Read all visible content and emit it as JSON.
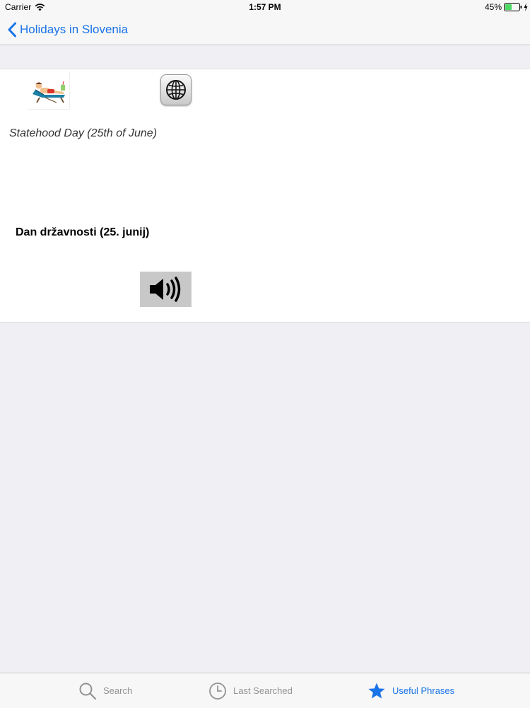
{
  "status_bar": {
    "carrier": "Carrier",
    "time": "1:57 PM",
    "battery": "45%",
    "icons": [
      "wifi-icon",
      "battery-icon",
      "charging-icon"
    ]
  },
  "nav": {
    "back_label": "Holidays in Slovenia"
  },
  "phrase": {
    "english": "Statehood Day (25th of June)",
    "slovene": "Dan državnosti (25. junij)"
  },
  "content_icons": [
    "holiday-beach-chair-image",
    "globe-icon",
    "speaker-icon"
  ],
  "tabs": [
    {
      "label": "Search",
      "icon": "search-icon",
      "active": false
    },
    {
      "label": "Last Searched",
      "icon": "clock-icon",
      "active": false
    },
    {
      "label": "Useful Phrases",
      "icon": "star-icon",
      "active": true
    }
  ],
  "colors": {
    "accent": "#1a73e8",
    "inactive_tab": "#929292",
    "background": "#efeff4",
    "bar_background": "#f7f7f7",
    "battery_fill": "#4cd964"
  }
}
